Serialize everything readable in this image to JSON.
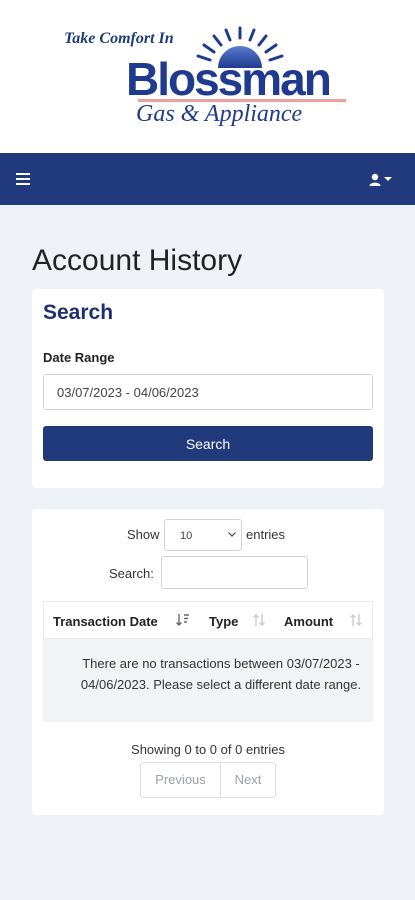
{
  "logo": {
    "tagline": "Take Comfort In",
    "brand": "Blossman",
    "subtitle": "Gas & Appliance",
    "brand_color": "#1f3a8f"
  },
  "navbar": {
    "menu_icon": "hamburger-icon",
    "user_icon": "user-dropdown-icon",
    "color": "#213a7c"
  },
  "page": {
    "title": "Account History"
  },
  "search": {
    "title": "Search",
    "date_label": "Date Range",
    "date_value": "03/07/2023 - 04/06/2023",
    "button_label": "Search"
  },
  "table": {
    "show_label": "Show",
    "entries_per_page": "10",
    "entries_label": "entries",
    "filter_label": "Search:",
    "filter_value": "",
    "columns": [
      "Transaction Date",
      "Type",
      "Amount"
    ],
    "empty_message": "There are no transactions between 03/07/2023 - 04/06/2023. Please select a different date range.",
    "info": "Showing 0 to 0 of 0 entries",
    "pagination": {
      "previous": "Previous",
      "next": "Next"
    }
  }
}
